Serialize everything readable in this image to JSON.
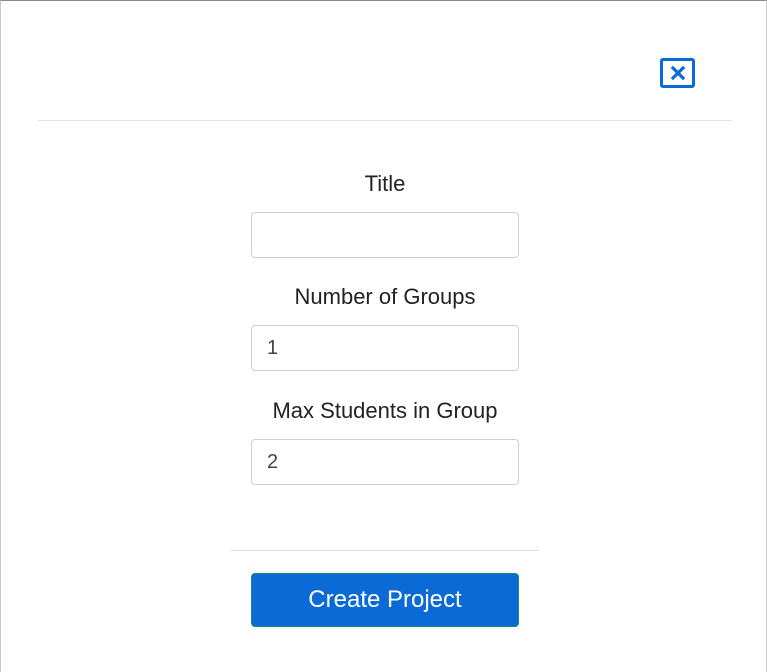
{
  "header": {
    "close_icon": "close-x-icon"
  },
  "form": {
    "title": {
      "label": "Title",
      "value": ""
    },
    "groups": {
      "label": "Number of Groups",
      "value": "1"
    },
    "max_students": {
      "label": "Max Students in Group",
      "value": "2"
    }
  },
  "footer": {
    "submit_label": "Create Project"
  },
  "colors": {
    "accent": "#0b6bd6",
    "button_border": "#1b8a7a"
  }
}
